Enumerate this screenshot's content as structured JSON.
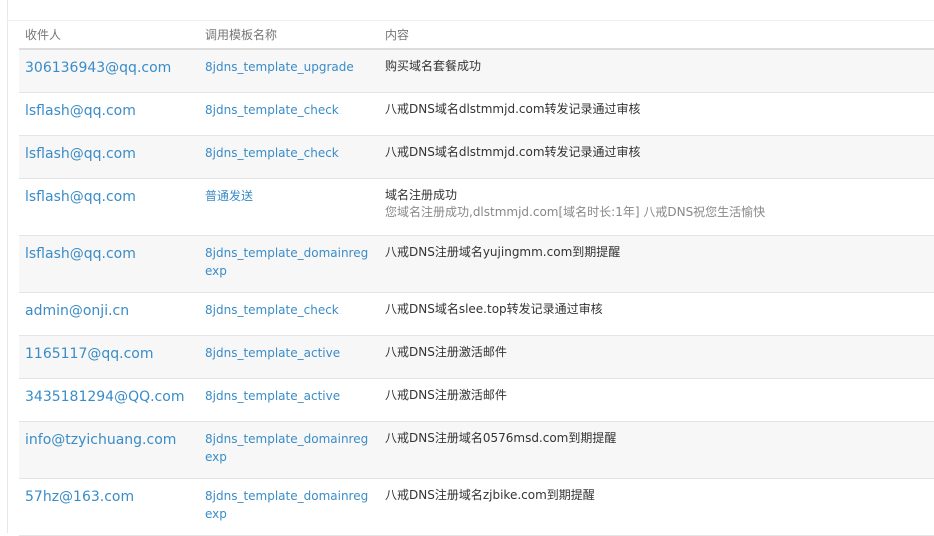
{
  "table": {
    "headers": {
      "recipient": "收件人",
      "template": "调用模板名称",
      "content": "内容"
    },
    "rows": [
      {
        "recipient": "306136943@qq.com",
        "template": "8jdns_template_upgrade",
        "content": "购买域名套餐成功",
        "content_sub": ""
      },
      {
        "recipient": "lsflash@qq.com",
        "template": "8jdns_template_check",
        "content": "八戒DNS域名dlstmmjd.com转发记录通过审核",
        "content_sub": ""
      },
      {
        "recipient": "lsflash@qq.com",
        "template": "8jdns_template_check",
        "content": "八戒DNS域名dlstmmjd.com转发记录通过审核",
        "content_sub": ""
      },
      {
        "recipient": "lsflash@qq.com",
        "template": "普通发送",
        "content": "域名注册成功",
        "content_sub": "您域名注册成功,dlstmmjd.com[域名时长:1年] 八戒DNS祝您生活愉快"
      },
      {
        "recipient": "lsflash@qq.com",
        "template": "8jdns_template_domainregexp",
        "content": "八戒DNS注册域名yujingmm.com到期提醒",
        "content_sub": ""
      },
      {
        "recipient": "admin@onji.cn",
        "template": "8jdns_template_check",
        "content": "八戒DNS域名slee.top转发记录通过审核",
        "content_sub": ""
      },
      {
        "recipient": "1165117@qq.com",
        "template": "8jdns_template_active",
        "content": "八戒DNS注册激活邮件",
        "content_sub": ""
      },
      {
        "recipient": "3435181294@QQ.com",
        "template": "8jdns_template_active",
        "content": "八戒DNS注册激活邮件",
        "content_sub": ""
      },
      {
        "recipient": "info@tzyichuang.com",
        "template": "8jdns_template_domainregexp",
        "content": "八戒DNS注册域名0576msd.com到期提醒",
        "content_sub": ""
      },
      {
        "recipient": "57hz@163.com",
        "template": "8jdns_template_domainregexp",
        "content": "八戒DNS注册域名zjbike.com到期提醒",
        "content_sub": ""
      }
    ]
  },
  "colors": {
    "link": "#3a8cc7",
    "text": "#333333",
    "muted": "#888888",
    "row_stripe": "#f7f7f7"
  }
}
